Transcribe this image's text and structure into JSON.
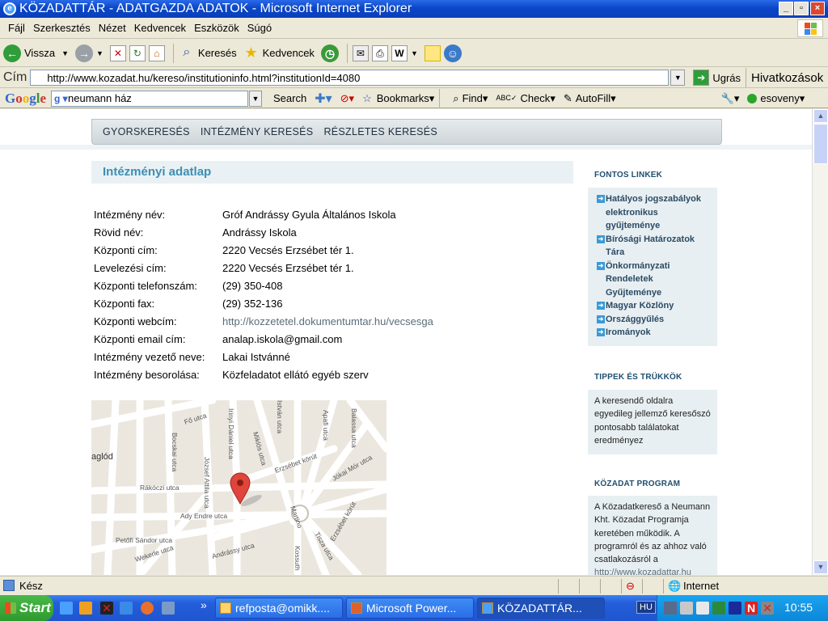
{
  "window": {
    "title": "KÖZADATTÁR - ADATGAZDA ADATOK - Microsoft Internet Explorer"
  },
  "menu": [
    "Fájl",
    "Szerkesztés",
    "Nézet",
    "Kedvencek",
    "Eszközök",
    "Súgó"
  ],
  "toolbar": {
    "back_label": "Vissza",
    "search_label": "Keresés",
    "favorites_label": "Kedvencek"
  },
  "address": {
    "label": "Cím",
    "url": "http://www.kozadat.hu/kereso/institutioninfo.html?institutionId=4080",
    "go_label": "Ugrás",
    "links_label": "Hivatkozások"
  },
  "google": {
    "logo": "Google",
    "query": "neumann ház",
    "search": "Search",
    "bookmarks": "Bookmarks",
    "find": "Find",
    "check": "Check",
    "autofill": "AutoFill",
    "user": "esoveny"
  },
  "nav": [
    "GYORSKERESÉS",
    "INTÉZMÉNY KERESÉS",
    "RÉSZLETES KERESÉS"
  ],
  "page": {
    "section_title": "Intézményi adatlap",
    "fields": [
      {
        "label": "Intézmény név:",
        "value": "Gróf Andrássy Gyula Általános Iskola"
      },
      {
        "label": "Rövid név:",
        "value": "Andrássy Iskola"
      },
      {
        "label": "Központi cím:",
        "value": "2220 Vecsés Erzsébet tér 1."
      },
      {
        "label": "Levelezési cím:",
        "value": "2220 Vecsés Erzsébet tér 1."
      },
      {
        "label": "Központi telefonszám:",
        "value": "(29) 350-408"
      },
      {
        "label": "Központi fax:",
        "value": "(29) 352-136"
      },
      {
        "label": "Központi webcím:",
        "value": "http://kozzetetel.dokumentumtar.hu/vecsesga"
      },
      {
        "label": "Központi email cím:",
        "value": "analap.iskola@gmail.com"
      },
      {
        "label": "Intézmény vezető neve:",
        "value": "Lakai Istvánné"
      },
      {
        "label": "Intézmény besorolása:",
        "value": "Közfeladatot ellátó egyéb szerv"
      }
    ]
  },
  "map": {
    "streets": [
      "Fő utca",
      "Irinyi Dániel utca",
      "István utca",
      "Apafi utca",
      "Balassa utca",
      "Bocskai utca",
      "Miklós utca",
      "Erzsébet körút",
      "József Attila utca",
      "Rákóczi utca",
      "Jókai Mór utca",
      "Ady Endre utca",
      "Petőfi Sándor utca",
      "Wekerle utca",
      "Andrássy utca",
      "Kossuth",
      "Tisza utca",
      "Erzsébet körút",
      "aglód",
      "Martino"
    ]
  },
  "sidebar": {
    "links_heading": "FONTOS LINKEK",
    "links": [
      "Hatályos jogszabályok elektronikus gyűjteménye",
      "Bírósági Határozatok Tára",
      "Önkormányzati Rendeletek Gyűjteménye",
      "Magyar Közlöny",
      "Országgyűlés",
      "Irományok"
    ],
    "tips_heading": "TIPPEK ÉS TRÜKKÖK",
    "tips_text": "A keresendő oldalra egyedileg jellemző keresőszó pontosabb találatokat eredményez",
    "program_heading": "KÖZADAT PROGRAM",
    "program_text": "A Közadatkereső a Neumann Kht. Közadat Programja keretében működik. A programról és az ahhoz való csatlakozásról a",
    "program_link": "http://www.kozadattar.hu"
  },
  "status": {
    "text": "Kész",
    "zone": "Internet"
  },
  "taskbar": {
    "start": "Start",
    "tasks": [
      "refposta@omikk....",
      "Microsoft Power...",
      "KÖZADATTÁR..."
    ],
    "lang": "HU",
    "clock": "10:55"
  },
  "colors": {
    "accent": "#3d8fb3",
    "taskbar": "#245edb",
    "start": "#2e9a2e"
  }
}
